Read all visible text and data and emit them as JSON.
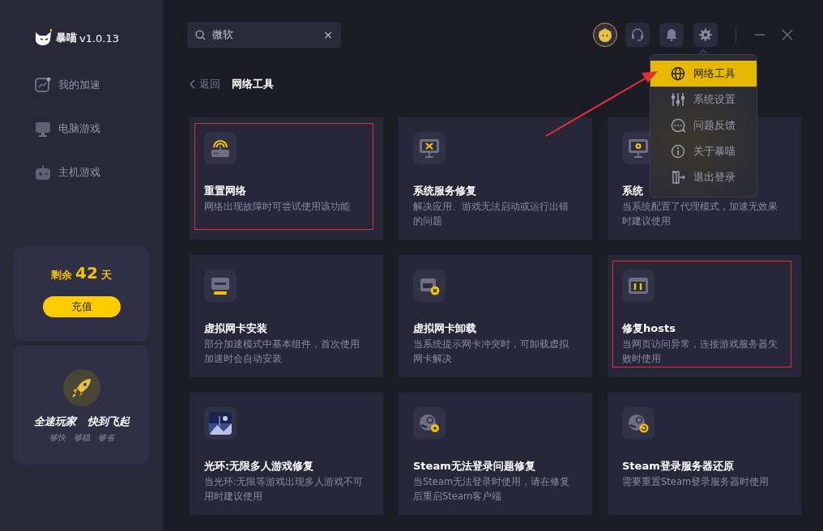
{
  "app": {
    "name": "暴喵",
    "version": "v1.0.13"
  },
  "sidebar": {
    "items": [
      {
        "label": "我的加速",
        "selected": false
      },
      {
        "label": "电脑游戏",
        "selected": false
      },
      {
        "label": "主机游戏",
        "selected": false
      }
    ],
    "balance": {
      "prefix": "剩余",
      "days": "42",
      "suffix": "天",
      "button": "充值"
    },
    "promo": {
      "slogan_1": "全速玩家",
      "slogan_2": "快到飞起",
      "tags": [
        "够快",
        "够稳",
        "够省"
      ]
    }
  },
  "search": {
    "value": "微软",
    "clear": "×"
  },
  "breadcrumb": {
    "back": "返回",
    "title": "网络工具"
  },
  "cards": [
    {
      "kind": "router",
      "title": "重置网络",
      "description": "网络出现故障时可尝试使用该功能",
      "highlighted": true
    },
    {
      "kind": "repair",
      "title": "系统服务修复",
      "description": "解决应用、游戏无法启动或运行出错的问题",
      "highlighted": false
    },
    {
      "kind": "proxy",
      "title": "系统",
      "description": "当系统配置了代理模式，加速无效果时建议使用",
      "highlighted": false
    },
    {
      "kind": "install",
      "title": "虚拟网卡安装",
      "description": "部分加速模式中基本组件，首次使用加速时会自动安装",
      "highlighted": false
    },
    {
      "kind": "uninstall",
      "title": "虚拟网卡卸载",
      "description": "当系统提示网卡冲突时，可卸载虚拟网卡解决",
      "highlighted": false
    },
    {
      "kind": "hosts",
      "title": "修复hosts",
      "description": "当网页访问异常，连接游戏服务器失败时使用",
      "highlighted": true
    },
    {
      "kind": "picture",
      "title": "光环:无限多人游戏修复",
      "description": "当光环:无限等游戏出现多人游戏不可用时建议使用",
      "highlighted": false
    },
    {
      "kind": "steamfix",
      "title": "Steam无法登录问题修复",
      "description": "当Steam无法登录时使用，请在修复后重启Steam客户端",
      "highlighted": false
    },
    {
      "kind": "steamrestore",
      "title": "Steam登录服务器还原",
      "description": "需要重置Steam登录服务器时使用",
      "highlighted": false
    }
  ],
  "menu": {
    "open": true,
    "items": [
      {
        "label": "网络工具",
        "selected": true
      },
      {
        "label": "系统设置",
        "selected": false
      },
      {
        "label": "问题反馈",
        "selected": false
      },
      {
        "label": "关于暴喵",
        "selected": false
      },
      {
        "label": "退出登录",
        "selected": false
      }
    ]
  },
  "annotation_arrow": true
}
